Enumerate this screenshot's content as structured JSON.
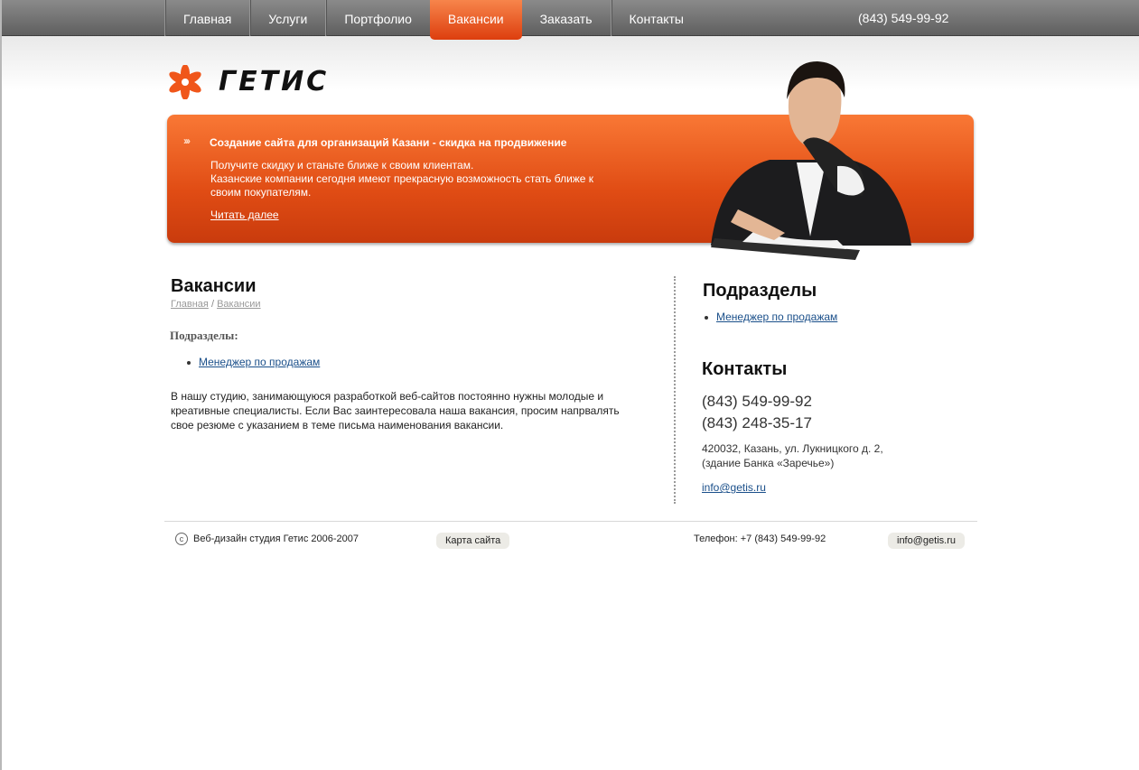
{
  "nav": {
    "items": [
      {
        "label": "Главная"
      },
      {
        "label": "Услуги"
      },
      {
        "label": "Портфолио"
      },
      {
        "label": "Вакансии"
      },
      {
        "label": "Заказать"
      },
      {
        "label": "Контакты"
      }
    ],
    "active_index": 3,
    "phone": "(843) 549-99-92"
  },
  "logo": {
    "text": "ГЕТИС"
  },
  "banner": {
    "title": "Создание сайта для организаций Казани - скидка на продвижение",
    "text": "Получите скидку и станьте ближе к своим клиентам.\nКазанские компании сегодня имеют прекрасную возможность стать ближе к своим покупателям.",
    "link": "Читать далее"
  },
  "main": {
    "title": "Вакансии",
    "breadcrumb": {
      "home": "Главная",
      "separator": "/",
      "current": "Вакансии"
    },
    "subsections_label": "Подразделы:",
    "subsections": [
      "Менеджер по продажам"
    ],
    "intro": "В нашу студию, занимающуюся разработкой веб-сайтов постоянно нужны молодые и креативные специалисты.  Если Вас заинтересовала наша вакансия, просим напрвалять свое резюме с указанием в теме письма наименования вакансии."
  },
  "sidebar": {
    "subsections_title": "Подразделы",
    "subsections": [
      "Менеджер по продажам"
    ],
    "contacts_title": "Контакты",
    "phone1": "(843) 549-99-92",
    "phone2": "(843) 248-35-17",
    "address_line1": "420032, Казань, ул. Лукницкого д. 2,",
    "address_line2": "(здание Банка «Заречье»)",
    "email": "info@getis.ru"
  },
  "footer": {
    "copyright": "Веб-дизайн студия Гетис 2006-2007",
    "sitemap": "Карта сайта",
    "phone": "Телефон: +7 (843) 549-99-92",
    "email": "info@getis.ru"
  },
  "colors": {
    "accent": "#e8511a",
    "link": "#1a4f8a",
    "topbar": "#6b6b6b"
  }
}
